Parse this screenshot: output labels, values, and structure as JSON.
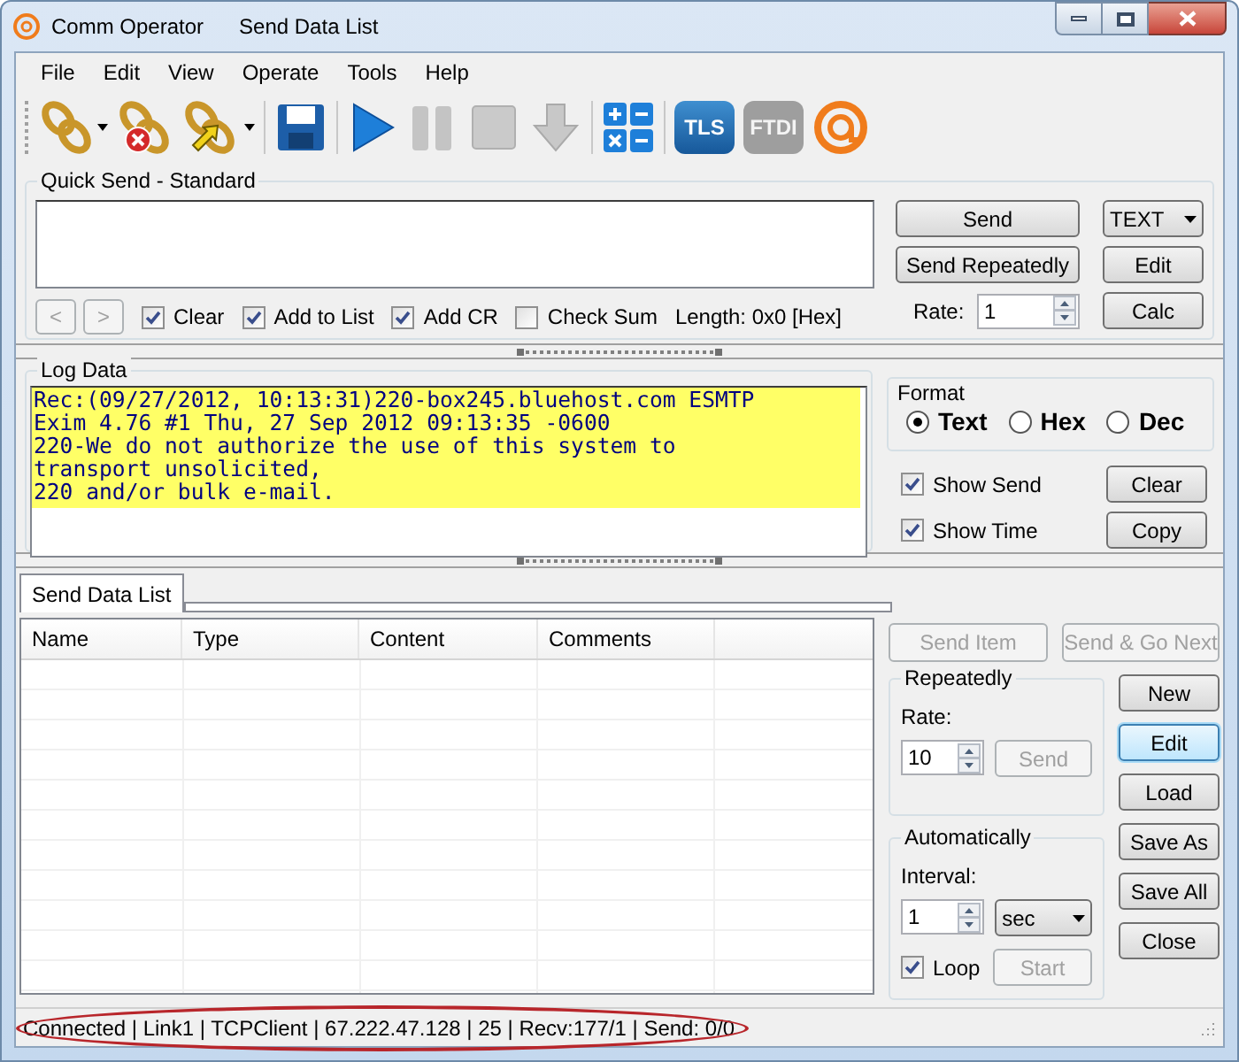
{
  "window": {
    "title": "Comm Operator",
    "subtitle": "Send Data List"
  },
  "menu": [
    "File",
    "Edit",
    "View",
    "Operate",
    "Tools",
    "Help"
  ],
  "toolbar": [
    {
      "kind": "connect",
      "dropdown": true,
      "disabled": false
    },
    {
      "kind": "disconnect",
      "dropdown": false,
      "disabled": false
    },
    {
      "kind": "reconnect",
      "dropdown": true,
      "disabled": false
    },
    {
      "kind": "save",
      "dropdown": false,
      "disabled": false
    },
    {
      "kind": "play",
      "dropdown": false,
      "disabled": false
    },
    {
      "kind": "pause",
      "dropdown": false,
      "disabled": true
    },
    {
      "kind": "stop",
      "dropdown": false,
      "disabled": true
    },
    {
      "kind": "download",
      "dropdown": false,
      "disabled": true
    },
    {
      "kind": "calculator",
      "dropdown": false,
      "disabled": false
    },
    {
      "kind": "badge",
      "label": "TLS",
      "dropdown": false,
      "disabled": false
    },
    {
      "kind": "badge",
      "label": "FTDI",
      "dropdown": false,
      "disabled": true
    },
    {
      "kind": "logo",
      "dropdown": false,
      "disabled": false
    }
  ],
  "quick_send": {
    "title": "Quick Send - Standard",
    "nav": [
      {
        "label": "<",
        "disabled": true
      },
      {
        "label": ">",
        "disabled": true
      }
    ],
    "checkboxes": [
      {
        "label": "Clear",
        "checked": true
      },
      {
        "label": "Add to List",
        "checked": true
      },
      {
        "label": "Add CR",
        "checked": true
      },
      {
        "label": "Check Sum",
        "checked": false
      }
    ],
    "length": "Length: 0x0 [Hex]",
    "send": "Send",
    "send_repeatedly": "Send Repeatedly",
    "rate_label": "Rate:",
    "rate": "1",
    "mode": "TEXT",
    "edit": "Edit",
    "calc": "Calc"
  },
  "log": {
    "title": "Log Data",
    "lines": [
      "Rec:(09/27/2012, 10:13:31)220-box245.bluehost.com ESMTP",
      "Exim 4.76 #1 Thu, 27 Sep 2012 09:13:35 -0600",
      "220-We do not authorize the use of this system to",
      "transport unsolicited,",
      "220 and/or bulk e-mail."
    ],
    "format": {
      "title": "Format",
      "options": [
        {
          "label": "Text",
          "selected": true
        },
        {
          "label": "Hex",
          "selected": false
        },
        {
          "label": "Dec",
          "selected": false
        }
      ]
    },
    "checkboxes": [
      {
        "label": "Show Send",
        "checked": true
      },
      {
        "label": "Show Time",
        "checked": true
      }
    ],
    "buttons": [
      "Clear",
      "Copy"
    ]
  },
  "send_list": {
    "tab": {
      "label": "Send Data List",
      "selected": true
    },
    "columns": [
      "Name",
      "Type",
      "Content",
      "Comments"
    ],
    "top_buttons": [
      {
        "label": "Send Item",
        "disabled": true
      },
      {
        "label": "Send & Go Next",
        "disabled": true
      }
    ],
    "repeatedly": {
      "title": "Repeatedly",
      "rate_label": "Rate:",
      "rate": "10",
      "send": {
        "label": "Send",
        "disabled": true
      }
    },
    "automatically": {
      "title": "Automatically",
      "interval_label": "Interval:",
      "interval": "1",
      "unit": "sec",
      "loop": {
        "label": "Loop",
        "checked": true
      },
      "start": {
        "label": "Start",
        "disabled": true
      }
    },
    "buttons": [
      {
        "label": "New",
        "focused": false
      },
      {
        "label": "Edit",
        "focused": true
      },
      {
        "label": "Load",
        "focused": false
      },
      {
        "label": "Save As",
        "focused": false
      },
      {
        "label": "Save All",
        "focused": false
      },
      {
        "label": "Close",
        "focused": false
      }
    ]
  },
  "status_bar": {
    "text": "Connected | Link1 | TCPClient | 67.222.47.128 | 25 | Recv:177/1 | Send: 0/0",
    "highlighted": true
  }
}
